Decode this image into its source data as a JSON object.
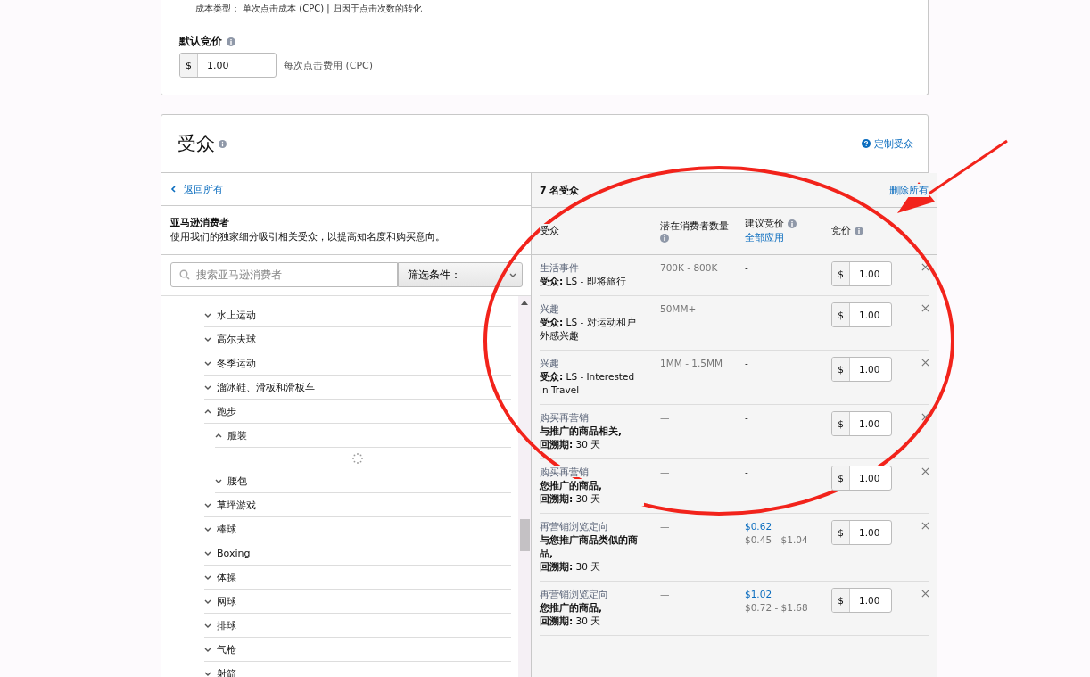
{
  "campaign_settings": {
    "cost_type_label": "成本类型：",
    "cost_type_value": "单次点击成本 (CPC) | 归因于点击次数的转化",
    "default_bid": {
      "label": "默认竞价",
      "currency": "$",
      "value": "1.00",
      "unit": "每次点击费用 (CPC)"
    }
  },
  "audience_card": {
    "title": "受众",
    "custom_link": "定制受众",
    "left": {
      "back_link": "返回所有",
      "category_title": "亚马逊消费者",
      "category_desc": "使用我们的独家细分吸引相关受众，以提高知名度和购买意向。",
      "search": {
        "placeholder": "搜索亚马逊消费者"
      },
      "filter": "筛选条件：",
      "tree": [
        {
          "label": "水上运动",
          "expanded": false
        },
        {
          "label": "高尔夫球",
          "expanded": false
        },
        {
          "label": "冬季运动",
          "expanded": false
        },
        {
          "label": "溜冰鞋、滑板和滑板车",
          "expanded": false
        },
        {
          "label": "跑步",
          "expanded": true,
          "children": [
            {
              "label": "服装",
              "expanded": true,
              "loading": true
            },
            {
              "label": "腰包",
              "expanded": false
            }
          ]
        },
        {
          "label": "草坪游戏",
          "expanded": false
        },
        {
          "label": "棒球",
          "expanded": false
        },
        {
          "label": "Boxing",
          "expanded": false
        },
        {
          "label": "体操",
          "expanded": false
        },
        {
          "label": "网球",
          "expanded": false
        },
        {
          "label": "排球",
          "expanded": false
        },
        {
          "label": "气枪",
          "expanded": false
        },
        {
          "label": "射箭",
          "expanded": false
        }
      ]
    },
    "right": {
      "count": "7 名受众",
      "remove_all": "删除所有",
      "columns": [
        "受众",
        "潜在消费者数量",
        "建议竞价",
        "竞价"
      ],
      "apply_all": "全部应用",
      "rows": [
        {
          "type": "生活事件",
          "details": [
            "**受众:** LS - 即将旅行"
          ],
          "reach": "700K - 800K",
          "suggested": "-",
          "currency": "$",
          "bid": "1.00"
        },
        {
          "type": "兴趣",
          "details": [
            "**受众:** LS - 对运动和户外感兴趣"
          ],
          "reach": "50MM+",
          "suggested": "-",
          "currency": "$",
          "bid": "1.00"
        },
        {
          "type": "兴趣",
          "details": [
            "**受众:** LS - Interested in Travel"
          ],
          "reach": "1MM - 1.5MM",
          "suggested": "-",
          "currency": "$",
          "bid": "1.00"
        },
        {
          "type": "购买再营销",
          "details": [
            "**与推广的商品相关,**",
            "**回溯期:** 30 天"
          ],
          "reach": "—",
          "suggested": "-",
          "currency": "$",
          "bid": "1.00"
        },
        {
          "type": "购买再营销",
          "details": [
            "**您推广的商品,**",
            "**回溯期:** 30 天"
          ],
          "reach": "—",
          "suggested": "-",
          "currency": "$",
          "bid": "1.00"
        },
        {
          "type": "再营销浏览定向",
          "details": [
            "**与您推广商品类似的商品,**",
            "**回溯期:** 30 天"
          ],
          "reach": "—",
          "suggested": "$0.62",
          "suggested_range": "$0.45 - $1.04",
          "currency": "$",
          "bid": "1.00"
        },
        {
          "type": "再营销浏览定向",
          "details": [
            "**您推广的商品,**",
            "**回溯期:** 30 天"
          ],
          "reach": "—",
          "suggested": "$1.02",
          "suggested_range": "$0.72 - $1.68",
          "currency": "$",
          "bid": "1.00"
        }
      ]
    }
  },
  "annotation": {
    "kind": "ellipse_with_arrow"
  }
}
